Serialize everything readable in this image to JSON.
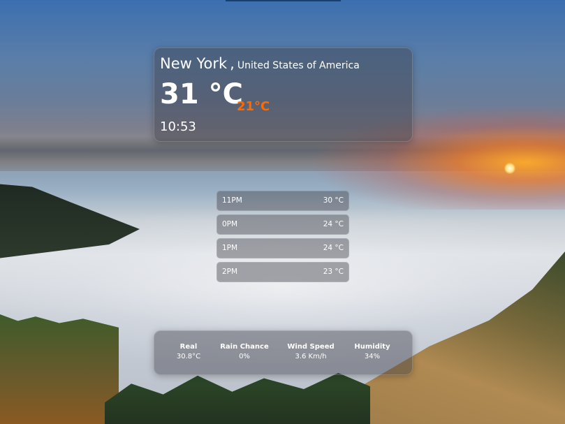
{
  "location": {
    "city": "New York",
    "separator": ",",
    "country": "United States of America"
  },
  "current": {
    "temperature": "31 °C",
    "feels_like": "21°C",
    "time": "10:53"
  },
  "hourly": [
    {
      "time": "11PM",
      "temp": "30 °C"
    },
    {
      "time": "0PM",
      "temp": "24 °C"
    },
    {
      "time": "1PM",
      "temp": "24 °C"
    },
    {
      "time": "2PM",
      "temp": "23 °C"
    }
  ],
  "stats": [
    {
      "label": "Real",
      "value": "30.8°C"
    },
    {
      "label": "Rain Chance",
      "value": "0%"
    },
    {
      "label": "Wind Speed",
      "value": "3.6 Km/h"
    },
    {
      "label": "Humidity",
      "value": "34%"
    }
  ],
  "colors": {
    "feels_like_accent": "#ff6a00"
  }
}
